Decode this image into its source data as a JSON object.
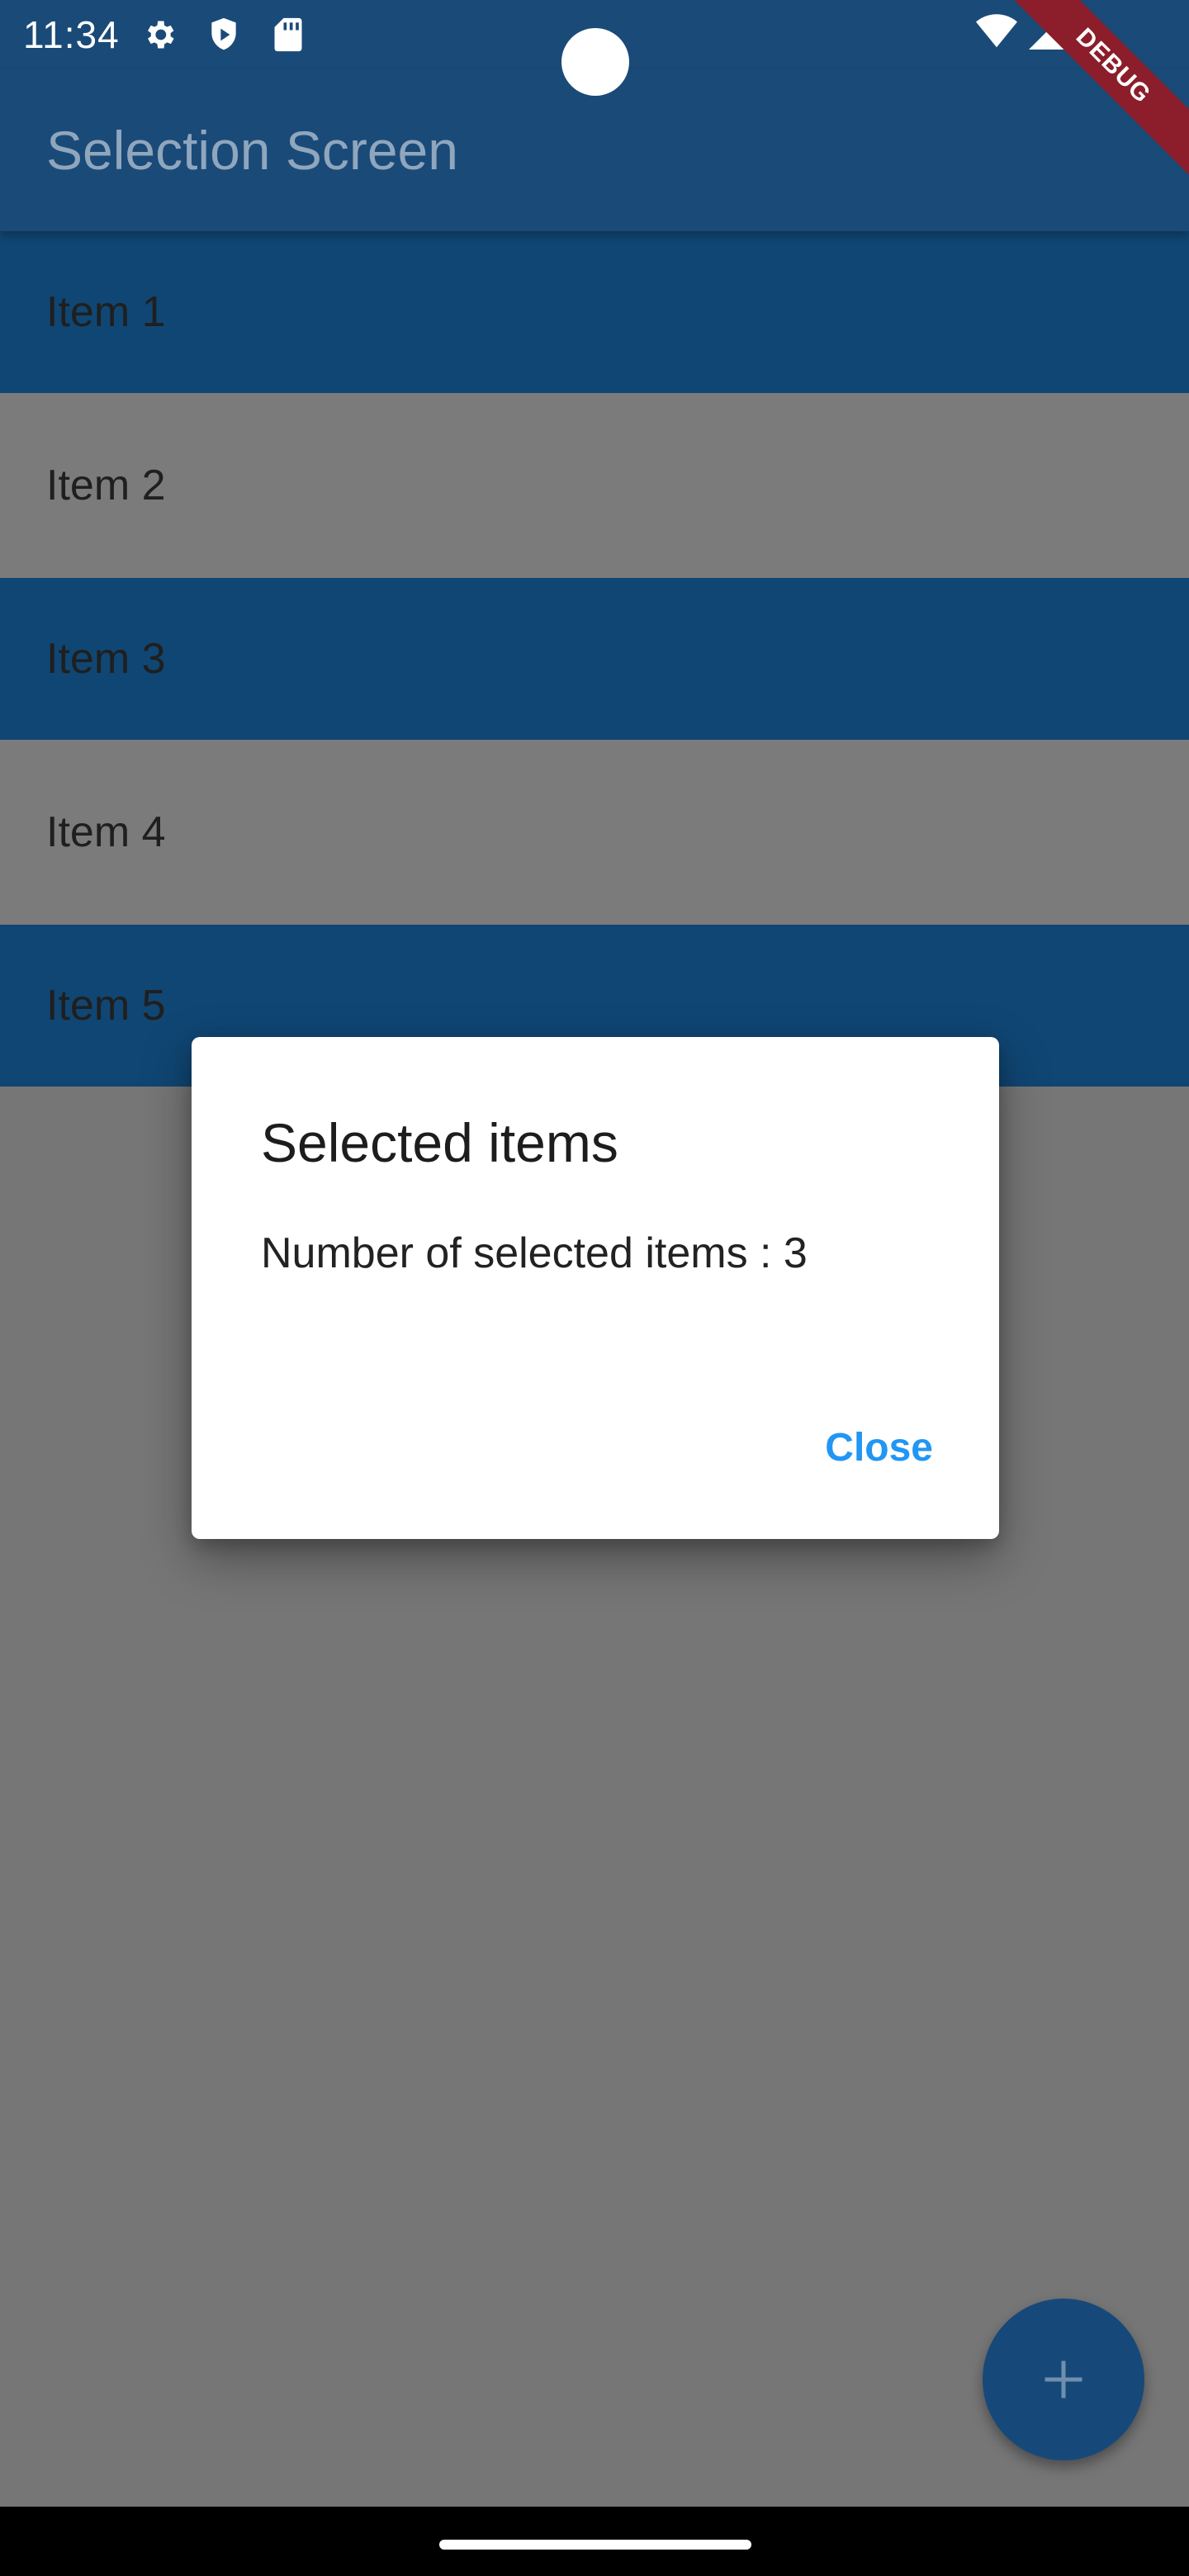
{
  "status_bar": {
    "time": "11:34",
    "icons": [
      "gear-icon",
      "shield-play-icon",
      "sd-card-icon",
      "wifi-icon",
      "signal-icon",
      "battery-icon"
    ]
  },
  "debug_banner": "DEBUG",
  "app_bar": {
    "title": "Selection Screen"
  },
  "list": {
    "items": [
      {
        "label": "Item 1",
        "selected": true
      },
      {
        "label": "Item 2",
        "selected": false
      },
      {
        "label": "Item 3",
        "selected": true
      },
      {
        "label": "Item 4",
        "selected": false
      },
      {
        "label": "Item 5",
        "selected": true
      }
    ]
  },
  "dialog": {
    "title": "Selected items",
    "content": "Number of selected items : 3",
    "close_label": "Close"
  },
  "fab": {
    "icon": "plus-icon"
  },
  "colors": {
    "primary": "#1A4A78",
    "selected_row": "#104673",
    "accent": "#2196F3",
    "scrim_background": "#767676"
  }
}
